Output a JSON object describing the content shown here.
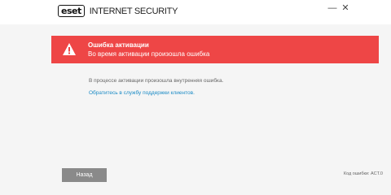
{
  "app": {
    "logo_badge": "eset",
    "product_name": "INTERNET SECURITY"
  },
  "window_controls": {
    "minimize_glyph": "—",
    "close_glyph": "✕"
  },
  "error": {
    "title": "Ошибка активации",
    "subtitle": "Во время активации произошла ошибка",
    "icon": "warning-triangle-icon",
    "banner_color": "#ee4646"
  },
  "content": {
    "message": "В процессе активации произошла внутренняя ошибка.",
    "support_link": "Обратитесь в службу поддержки клиентов.",
    "link_color": "#1a8ac5"
  },
  "footer": {
    "back_label": "Назад",
    "error_code": "Код ошибки: ACT.0"
  }
}
